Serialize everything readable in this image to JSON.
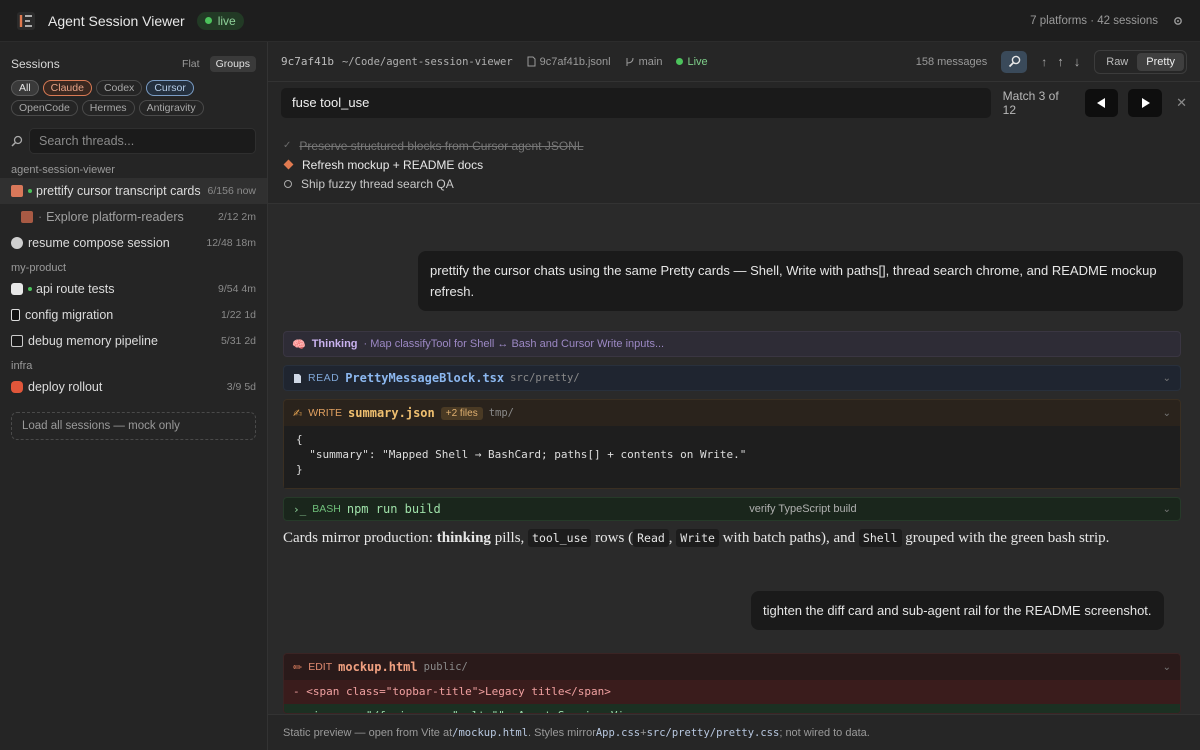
{
  "app": {
    "title": "Agent Session Viewer",
    "status": "live",
    "summary": "7 platforms · 42 sessions"
  },
  "sidebar": {
    "label": "Sessions",
    "view_modes": [
      "Flat",
      "Groups"
    ],
    "filters": [
      "All",
      "Claude",
      "Codex",
      "Cursor",
      "OpenCode",
      "Hermes",
      "Antigravity"
    ],
    "search_placeholder": "Search threads...",
    "groups": [
      {
        "name": "agent-session-viewer",
        "items": [
          {
            "title": "prettify cursor transcript cards",
            "count": "6/156",
            "time": "now"
          },
          {
            "title": "Explore platform-readers",
            "count": "2/12",
            "time": "2m"
          },
          {
            "title": "resume compose session",
            "count": "12/48",
            "time": "18m"
          }
        ]
      },
      {
        "name": "my-product",
        "items": [
          {
            "title": "api route tests",
            "count": "9/54",
            "time": "4m"
          },
          {
            "title": "config migration",
            "count": "1/22",
            "time": "1d"
          },
          {
            "title": "debug memory pipeline",
            "count": "5/31",
            "time": "2d"
          }
        ]
      },
      {
        "name": "infra",
        "items": [
          {
            "title": "deploy rollout",
            "count": "3/9",
            "time": "5d"
          }
        ]
      }
    ],
    "load_all": "Load all sessions — mock only"
  },
  "header": {
    "hash": "9c7af41b",
    "path": "~/Code/agent-session-viewer",
    "file": "9c7af41b.jsonl",
    "branch": "main",
    "live": "Live",
    "messages": "158 messages",
    "modes": [
      "Raw",
      "Pretty"
    ]
  },
  "search": {
    "query": "fuse tool_use",
    "match": "Match 3 of 12"
  },
  "todos": [
    {
      "text": "Preserve structured blocks from Cursor agent JSONL",
      "state": "done"
    },
    {
      "text": "Refresh mockup + README docs",
      "state": "progress"
    },
    {
      "text": "Ship fuzzy thread search QA",
      "state": "pending"
    }
  ],
  "messages": {
    "user1": "prettify the cursor chats using the same Pretty cards — Shell, Write with paths[], thread search chrome, and README mockup refresh.",
    "thinking_label": "Thinking",
    "thinking_text": "· Map classifyTool for Shell ↔ Bash and Cursor Write inputs...",
    "read": {
      "tag": "READ",
      "file": "PrettyMessageBlock.tsx",
      "dir": "src/pretty/"
    },
    "write": {
      "tag": "WRITE",
      "file": "summary.json",
      "extra": "+2 files",
      "dir": "tmp/",
      "code": [
        "{",
        "  \"summary\": \"Mapped Shell → BashCard; paths[] + contents on Write.\"",
        "}"
      ]
    },
    "bash": {
      "tag": "BASH",
      "cmd": "npm run build",
      "desc": "verify TypeScript build"
    },
    "prose": {
      "p1": "Cards mirror production: ",
      "bold": "thinking",
      "p2": " pills, ",
      "c1": "tool_use",
      "p3": " rows (",
      "c2": "Read",
      "p4": ", ",
      "c3": "Write",
      "p5": " with batch paths), and ",
      "c4": "Shell",
      "p6": " grouped with the green bash strip."
    },
    "user2": "tighten the diff card and sub-agent rail for the README screenshot.",
    "edit": {
      "tag": "EDIT",
      "file": "mockup.html",
      "dir": "public/",
      "minus": "- <span class=\"topbar-title\">Legacy title</span>",
      "plus": "+ <img src=\"/favicon.svg\" alt=\"\"> Agent Session Viewer"
    }
  },
  "footer": {
    "a": "Static preview — open from Vite at ",
    "b": "/mockup.html",
    "c": ". Styles mirror ",
    "d": "App.css",
    "e": " + ",
    "f": "src/pretty/pretty.css",
    "g": "; not wired to data."
  }
}
